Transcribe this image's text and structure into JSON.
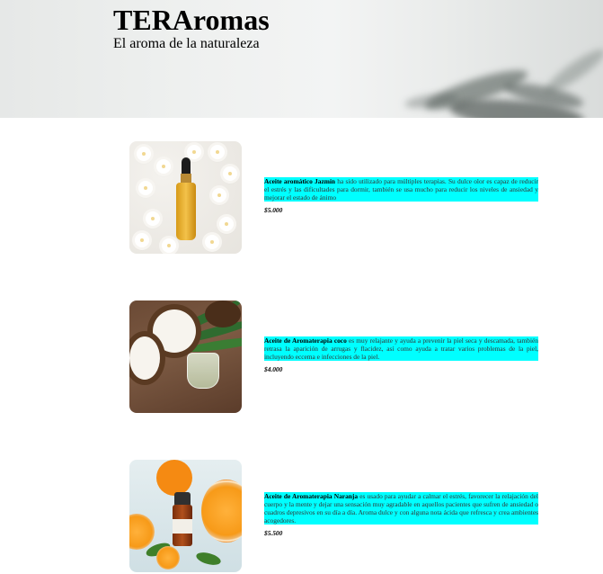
{
  "header": {
    "title": "TERAromas",
    "subtitle": "El aroma de la naturaleza"
  },
  "products": [
    {
      "name": "Aceite aromático Jazmín",
      "description": " ha sido utilizado para múltiples terapias. Su dulce olor es capaz de reducir el estrés y las dificultades para dormir, también se usa mucho para reducir los niveles de ansiedad y mejorar el estado de ánimo",
      "price": "$5.000",
      "image": "jasmine-oil-photo"
    },
    {
      "name": "Aceite de Aromaterapia coco",
      "description": " es muy relajante y ayuda a prevenir la piel seca y descamada, también retrasa la aparición de arrugas y flacidez, así como ayuda a tratar varios problemas de la piel, incluyendo eccema e infecciones de la piel.",
      "price": "$4.000",
      "image": "coconut-oil-photo"
    },
    {
      "name": "Aceite de Aromaterapia Naranja",
      "description": " es usado para ayudar a calmar el estrés, favorecer la relajación del cuerpo y la mente y dejar una sensación muy agradable en aquellos pacientes que sufren de ansiedad o cuadros depresivos en su día a día. Aroma dulce y con alguna nota ácida que refresca y crea ambientes acogedores.",
      "price": "$5.500",
      "image": "orange-oil-photo"
    }
  ],
  "colors": {
    "highlight": "#00ffff",
    "background": "#ffffff"
  }
}
